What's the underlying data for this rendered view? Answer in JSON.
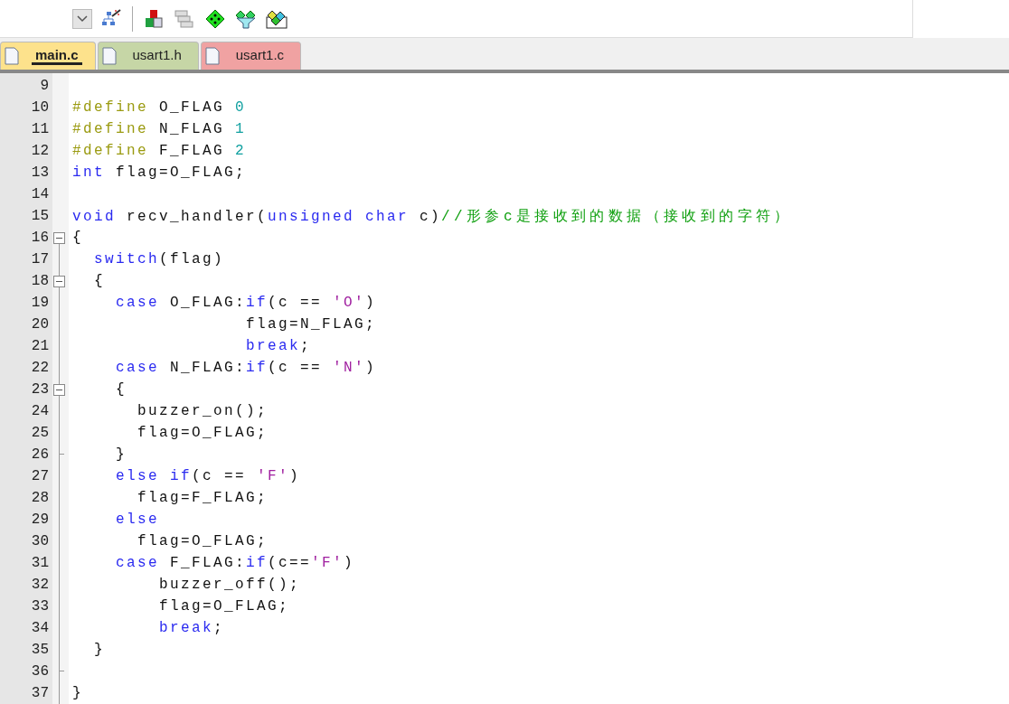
{
  "tabs": [
    {
      "label": "main.c",
      "selected": true,
      "color": "#fde28c"
    },
    {
      "label": "usart1.h",
      "selected": false,
      "color": "#c6d6a6"
    },
    {
      "label": "usart1.c",
      "selected": false,
      "color": "#f0a2a2"
    }
  ],
  "lines": [
    {
      "number": "9"
    },
    {
      "number": "10",
      "tokens": [
        {
          "kind": "preproc",
          "text": "#define"
        },
        {
          "kind": "plain",
          "text": " O_FLAG "
        },
        {
          "kind": "number",
          "text": "0"
        }
      ]
    },
    {
      "number": "11",
      "tokens": [
        {
          "kind": "preproc",
          "text": "#define"
        },
        {
          "kind": "plain",
          "text": " N_FLAG "
        },
        {
          "kind": "number",
          "text": "1"
        }
      ]
    },
    {
      "number": "12",
      "tokens": [
        {
          "kind": "preproc",
          "text": "#define"
        },
        {
          "kind": "plain",
          "text": " F_FLAG "
        },
        {
          "kind": "number",
          "text": "2"
        }
      ]
    },
    {
      "number": "13",
      "tokens": [
        {
          "kind": "keyword",
          "text": "int"
        },
        {
          "kind": "plain",
          "text": " flag=O_FLAG;"
        }
      ]
    },
    {
      "number": "14"
    },
    {
      "number": "15",
      "tokens": [
        {
          "kind": "keyword",
          "text": "void"
        },
        {
          "kind": "plain",
          "text": " recv_handler("
        },
        {
          "kind": "keyword",
          "text": "unsigned char"
        },
        {
          "kind": "plain",
          "text": " c)"
        },
        {
          "kind": "comment",
          "text": "//形参c是接收到的数据（接收到的字符）"
        }
      ]
    },
    {
      "number": "16",
      "kind": "fold_start",
      "expanded": true,
      "tokens": [
        {
          "kind": "plain",
          "text": "{"
        }
      ]
    },
    {
      "number": "17",
      "tokens": [
        {
          "kind": "keyword",
          "text": "  switch"
        },
        {
          "kind": "plain",
          "text": "(flag)"
        }
      ]
    },
    {
      "number": "18",
      "kind": "fold_start",
      "expanded": true,
      "tokens": [
        {
          "kind": "plain",
          "text": "  {"
        }
      ]
    },
    {
      "number": "19",
      "tokens": [
        {
          "kind": "keyword",
          "text": "    case"
        },
        {
          "kind": "plain",
          "text": " O_FLAG:"
        },
        {
          "kind": "keyword",
          "text": "if"
        },
        {
          "kind": "plain",
          "text": "(c == "
        },
        {
          "kind": "string",
          "text": "'O'"
        },
        {
          "kind": "plain",
          "text": ")"
        }
      ]
    },
    {
      "number": "20",
      "tokens": [
        {
          "kind": "plain",
          "text": "                flag=N_FLAG;"
        }
      ]
    },
    {
      "number": "21",
      "tokens": [
        {
          "kind": "keyword",
          "text": "                break"
        },
        {
          "kind": "plain",
          "text": ";"
        }
      ]
    },
    {
      "number": "22",
      "tokens": [
        {
          "kind": "keyword",
          "text": "    case"
        },
        {
          "kind": "plain",
          "text": " N_FLAG:"
        },
        {
          "kind": "keyword",
          "text": "if"
        },
        {
          "kind": "plain",
          "text": "(c == "
        },
        {
          "kind": "string",
          "text": "'N'"
        },
        {
          "kind": "plain",
          "text": ")"
        }
      ]
    },
    {
      "number": "23",
      "kind": "fold_start",
      "expanded": true,
      "tokens": [
        {
          "kind": "plain",
          "text": "    {"
        }
      ]
    },
    {
      "number": "24",
      "tokens": [
        {
          "kind": "plain",
          "text": "      buzzer_on();"
        }
      ]
    },
    {
      "number": "25",
      "tokens": [
        {
          "kind": "plain",
          "text": "      flag=O_FLAG;"
        }
      ]
    },
    {
      "number": "26",
      "kind": "fold_end",
      "tokens": [
        {
          "kind": "plain",
          "text": "    }"
        }
      ]
    },
    {
      "number": "27",
      "tokens": [
        {
          "kind": "keyword",
          "text": "    else if"
        },
        {
          "kind": "plain",
          "text": "(c == "
        },
        {
          "kind": "string",
          "text": "'F'"
        },
        {
          "kind": "plain",
          "text": ")"
        }
      ]
    },
    {
      "number": "28",
      "tokens": [
        {
          "kind": "plain",
          "text": "      flag=F_FLAG;"
        }
      ]
    },
    {
      "number": "29",
      "tokens": [
        {
          "kind": "keyword",
          "text": "    else"
        }
      ]
    },
    {
      "number": "30",
      "tokens": [
        {
          "kind": "plain",
          "text": "      flag=O_FLAG;"
        }
      ]
    },
    {
      "number": "31",
      "tokens": [
        {
          "kind": "keyword",
          "text": "    case"
        },
        {
          "kind": "plain",
          "text": " F_FLAG:"
        },
        {
          "kind": "keyword",
          "text": "if"
        },
        {
          "kind": "plain",
          "text": "(c=="
        },
        {
          "kind": "string",
          "text": "'F'"
        },
        {
          "kind": "plain",
          "text": ")"
        }
      ]
    },
    {
      "number": "32",
      "tokens": [
        {
          "kind": "plain",
          "text": "        buzzer_off();"
        }
      ]
    },
    {
      "number": "33",
      "tokens": [
        {
          "kind": "plain",
          "text": "        flag=O_FLAG;"
        }
      ]
    },
    {
      "number": "34",
      "tokens": [
        {
          "kind": "keyword",
          "text": "        break"
        },
        {
          "kind": "plain",
          "text": ";"
        }
      ]
    },
    {
      "number": "35",
      "tokens": [
        {
          "kind": "plain",
          "text": "  }"
        }
      ]
    },
    {
      "number": "36",
      "kind": "fold_end"
    },
    {
      "number": "37",
      "tokens": [
        {
          "kind": "plain",
          "text": "}"
        }
      ]
    }
  ]
}
